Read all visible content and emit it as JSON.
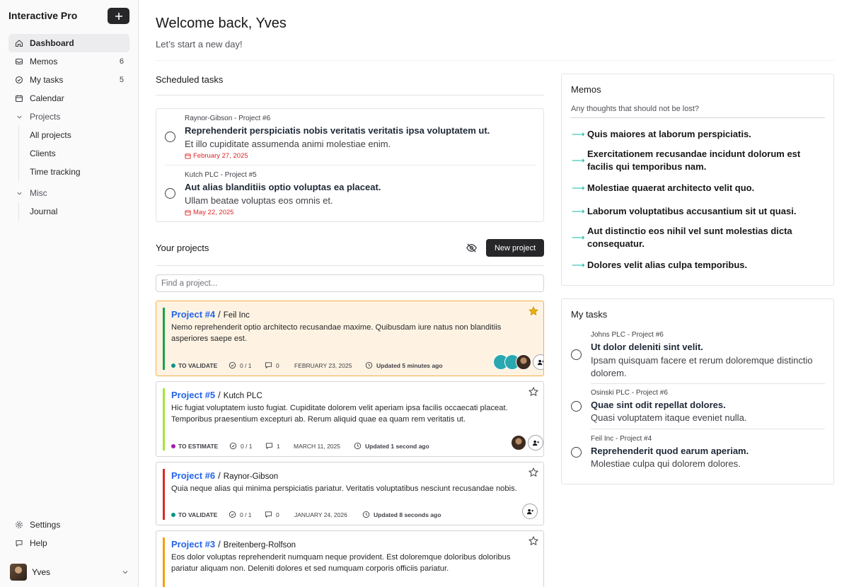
{
  "app": {
    "title": "Interactive Pro",
    "user_name": "Yves"
  },
  "sidebar": {
    "items": [
      {
        "label": "Dashboard",
        "count": ""
      },
      {
        "label": "Memos",
        "count": "6"
      },
      {
        "label": "My tasks",
        "count": "5"
      },
      {
        "label": "Calendar",
        "count": ""
      }
    ],
    "projects_group": "Projects",
    "projects_sub": [
      "All projects",
      "Clients",
      "Time tracking"
    ],
    "misc_group": "Misc",
    "misc_sub": [
      "Journal"
    ],
    "bottom": [
      "Settings",
      "Help"
    ]
  },
  "header": {
    "title": "Welcome back, Yves",
    "subtitle": "Let’s start a new day!"
  },
  "scheduled": {
    "title": "Scheduled tasks",
    "tasks": [
      {
        "meta": "Raynor-Gibson - Project #6",
        "title": "Reprehenderit perspiciatis nobis veritatis veritatis ipsa voluptatem ut.",
        "desc": "Et illo cupiditate assumenda animi molestiae enim.",
        "date": "February 27, 2025"
      },
      {
        "meta": "Kutch PLC - Project #5",
        "title": "Aut alias blanditiis optio voluptas ea placeat.",
        "desc": "Ullam beatae voluptas eos omnis et.",
        "date": "May 22, 2025"
      }
    ]
  },
  "projects": {
    "title": "Your projects",
    "new_label": "New project",
    "search_placeholder": "Find a project...",
    "list": [
      {
        "name": "Project #4",
        "company": "Feil Inc",
        "desc": "Nemo reprehenderit optio architecto recusandae maxime. Quibusdam iure natus non blanditiis asperiores saepe est.",
        "status": "TO VALIDATE",
        "status_color": "#0d9488",
        "bar_color": "#16a34a",
        "tasks": "0 / 1",
        "comments": "0",
        "date": "FEBRUARY 23, 2025",
        "updated": "Updated 5 minutes ago",
        "starred": true
      },
      {
        "name": "Project #5",
        "company": "Kutch PLC",
        "desc": "Hic fugiat voluptatem iusto fugiat. Cupiditate dolorem velit aperiam ipsa facilis occaecati placeat. Temporibus praesentium excepturi ab. Rerum aliquid quae ea quam rem veritatis ut.",
        "status": "TO ESTIMATE",
        "status_color": "#a21caf",
        "bar_color": "#a3e635",
        "tasks": "0 / 1",
        "comments": "1",
        "date": "MARCH 11, 2025",
        "updated": "Updated 1 second ago",
        "starred": false
      },
      {
        "name": "Project #6",
        "company": "Raynor-Gibson",
        "desc": "Quia neque alias qui minima perspiciatis pariatur. Veritatis voluptatibus nesciunt recusandae nobis.",
        "status": "TO VALIDATE",
        "status_color": "#0d9488",
        "bar_color": "#dc2626",
        "tasks": "0 / 1",
        "comments": "0",
        "date": "JANUARY 24, 2026",
        "updated": "Updated 8 seconds ago",
        "starred": false
      },
      {
        "name": "Project #3",
        "company": "Breitenberg-Rolfson",
        "desc": "Eos dolor voluptas reprehenderit numquam neque provident. Est doloremque doloribus doloribus pariatur aliquam non. Deleniti dolores et sed numquam corporis officiis pariatur.",
        "status": "",
        "status_color": "#0d9488",
        "bar_color": "#f59e0b",
        "tasks": "",
        "comments": "",
        "date": "",
        "updated": "",
        "starred": false
      }
    ]
  },
  "memos": {
    "title": "Memos",
    "placeholder": "Any thoughts that should not be lost?",
    "items": [
      "Quis maiores at laborum perspiciatis.",
      "Exercitationem recusandae incidunt dolorum est facilis qui temporibus nam.",
      "Molestiae quaerat architecto velit quo.",
      "Laborum voluptatibus accusantium sit ut quasi.",
      "Aut distinctio eos nihil vel sunt molestias dicta consequatur.",
      "Dolores velit alias culpa temporibus."
    ]
  },
  "my_tasks": {
    "title": "My tasks",
    "items": [
      {
        "meta": "Johns PLC - Project #6",
        "title": "Ut dolor deleniti sint velit.",
        "desc": "Ipsam quisquam facere et rerum doloremque distinctio dolorem."
      },
      {
        "meta": "Osinski PLC - Project #6",
        "title": "Quae sint odit repellat dolores.",
        "desc": "Quasi voluptatem itaque eveniet nulla."
      },
      {
        "meta": "Feil Inc - Project #4",
        "title": "Reprehenderit quod earum aperiam.",
        "desc": "Molestiae culpa qui dolorem dolores."
      }
    ]
  }
}
